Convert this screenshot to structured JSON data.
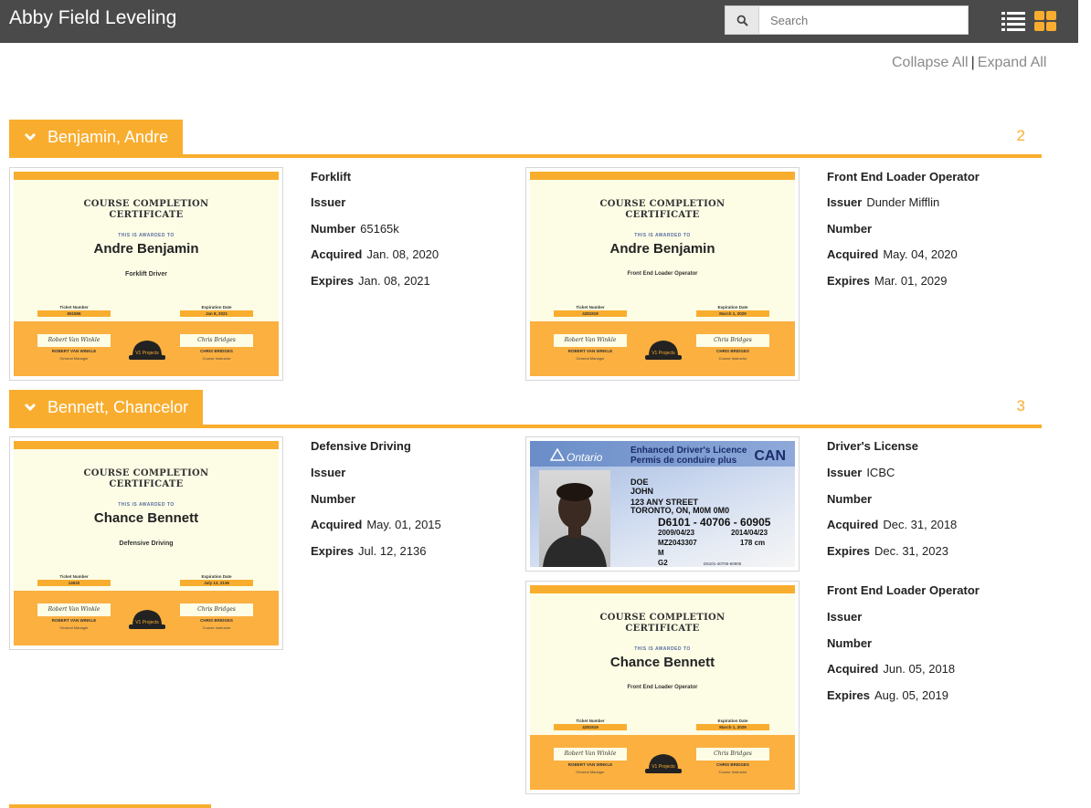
{
  "header": {
    "title": "Abby Field Leveling",
    "search_placeholder": "Search"
  },
  "toolbar": {
    "collapse_all": "Collapse All",
    "separator": "|",
    "expand_all": "Expand All"
  },
  "labels": {
    "issuer": "Issuer",
    "number": "Number",
    "acquired": "Acquired",
    "expires": "Expires"
  },
  "certificate_template": {
    "title_line1": "COURSE COMPLETION",
    "title_line2": "CERTIFICATE",
    "awarded_to": "THIS IS AWARDED TO",
    "ticket_label": "Ticket Number",
    "expiration_label": "Expiration Date",
    "signer_left_signature": "Robert Van Winkle",
    "signer_left_name": "ROBERT VAN WINKLE",
    "signer_left_title": "General Manager",
    "signer_right_signature": "Chris Bridges",
    "signer_right_name": "CHRIS BRIDGES",
    "signer_right_title": "Course Instructor",
    "logo_text": "V1 Projects"
  },
  "groups": [
    {
      "name": "Benjamin, Andre",
      "count": "2",
      "certs": [
        {
          "type": "Forklift",
          "issuer": "",
          "number": "65165k",
          "acquired": "Jan. 08, 2020",
          "expires": "Jan. 08, 2021",
          "image": {
            "name": "Andre Benjamin",
            "role": "Forklift Driver",
            "ticket": "651656",
            "expiration": "Jan 8, 2021"
          }
        },
        {
          "type": "Front End Loader Operator",
          "issuer": "Dunder Mifflin",
          "number": "",
          "acquired": "May. 04, 2020",
          "expires": "Mar. 01, 2029",
          "image": {
            "name": "Andre Benjamin",
            "role": "Front End Loader Operator",
            "ticket": "4281919",
            "expiration": "March 1, 2029"
          }
        }
      ]
    },
    {
      "name": "Bennett, Chancelor",
      "count": "3",
      "certs": [
        {
          "type": "Defensive Driving",
          "issuer": "",
          "number": "",
          "acquired": "May. 01, 2015",
          "expires": "Jul. 12, 2136",
          "image": {
            "name": "Chance Bennett",
            "role": "Defensive Driving",
            "ticket": "14632",
            "expiration": "July 12, 2136"
          }
        },
        {
          "type": "Driver's License",
          "issuer": "ICBC",
          "number": "",
          "acquired": "Dec. 31, 2018",
          "expires": "Dec. 31, 2023",
          "license": {
            "province": "Ontario",
            "heading_en": "Enhanced Driver's Licence",
            "heading_fr": "Permis de conduire plus",
            "country": "CAN",
            "last_name": "DOE",
            "first_name": "JOHN",
            "address1": "123 ANY STREET",
            "address2": "TORONTO, ON, M0M 0M0",
            "number": "D6101 - 40706 - 60905",
            "issued": "2009/04/23",
            "expiry": "2014/04/23",
            "dd": "MZ2043307",
            "height": "178 cm",
            "sex": "M",
            "class": "G2",
            "barcode_text": "D6101-40706-60905"
          }
        },
        {
          "type": "Front End Loader Operator",
          "issuer": "",
          "number": "",
          "acquired": "Jun. 05, 2018",
          "expires": "Aug. 05, 2019",
          "image": {
            "name": "Chance Bennett",
            "role": "Front End Loader Operator",
            "ticket": "4281919",
            "expiration": "March 1, 2029"
          }
        }
      ]
    }
  ],
  "colors": {
    "accent": "#f9ad2e",
    "topbar": "#4a4a4a",
    "certificate_bg": "#fdfde6"
  }
}
